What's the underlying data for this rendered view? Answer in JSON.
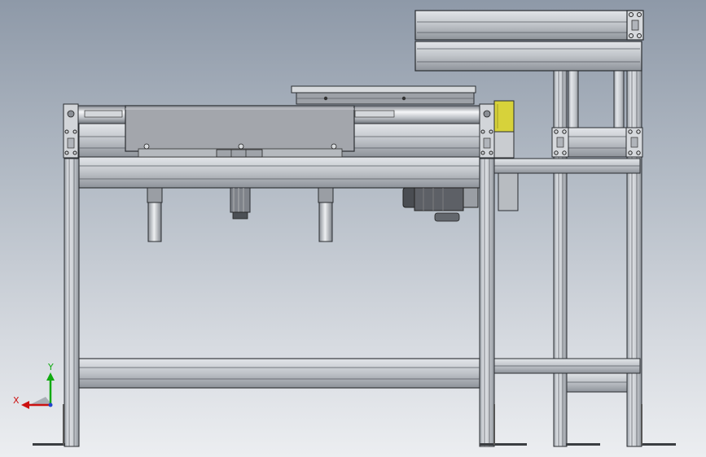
{
  "view": {
    "triad": {
      "x_label": "X",
      "y_label": "Y",
      "x_color": "#cc1111",
      "y_color": "#11aa11",
      "z_color": "#2244cc"
    },
    "colors": {
      "background_top": "#8e99a8",
      "background_bottom": "#eceef1",
      "frame_metal": "#c7cbd0",
      "frame_edge": "#2a2d31",
      "roller_highlight": "#f4f6f8",
      "plate": "#a4a7ad",
      "motor": "#55585d",
      "sensor_yellow": "#d7d23a"
    },
    "components": [
      "aluminum-profile-frame",
      "conveyor-roller",
      "cover-plate",
      "guide-cylinders",
      "drive-motor",
      "upper-rail",
      "yellow-sensor",
      "top-frame-box",
      "floor-feet"
    ]
  }
}
